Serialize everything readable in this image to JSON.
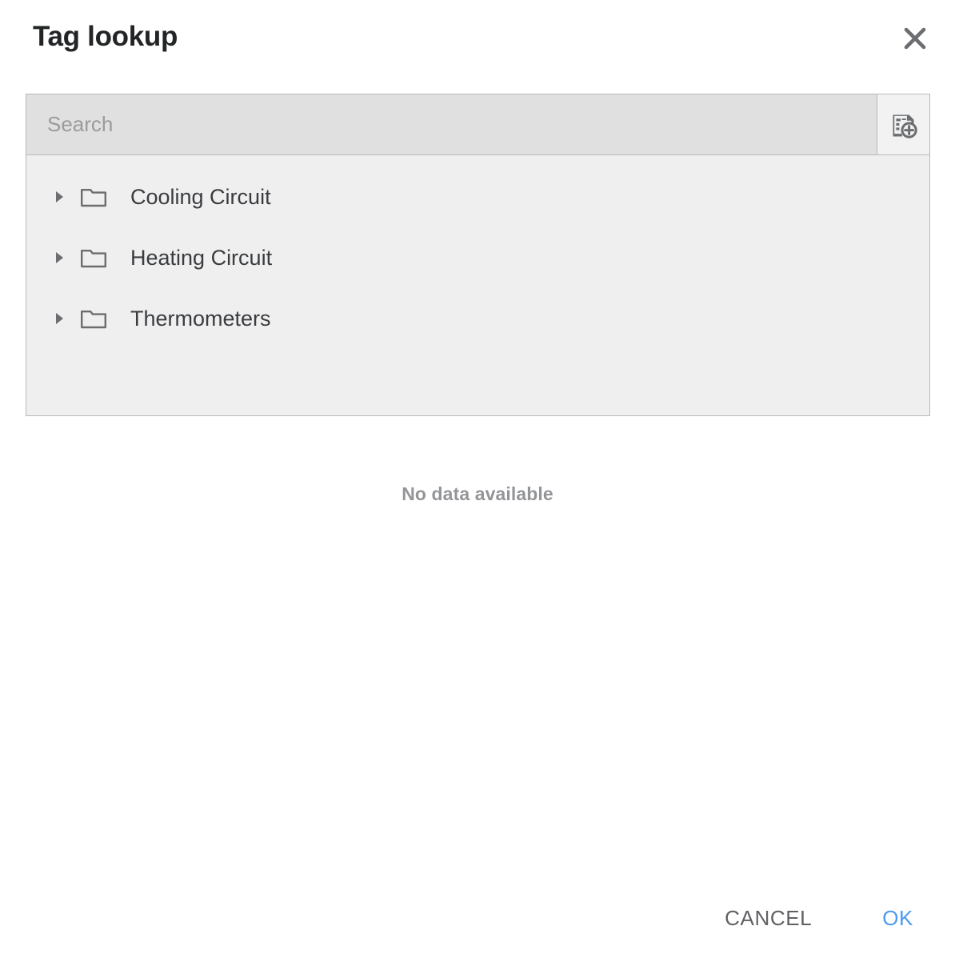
{
  "dialog": {
    "title": "Tag lookup",
    "close_icon": "close-icon"
  },
  "search": {
    "value": "",
    "placeholder": "Search",
    "action_icon": "add-tag-icon",
    "action_title": "Add tag"
  },
  "tree": {
    "items": [
      {
        "label": "Cooling Circuit",
        "icon": "folder-icon",
        "expanded": false
      },
      {
        "label": "Heating Circuit",
        "icon": "folder-icon",
        "expanded": false
      },
      {
        "label": "Thermometers",
        "icon": "folder-icon",
        "expanded": false
      }
    ]
  },
  "content": {
    "empty_message": "No data available"
  },
  "footer": {
    "cancel_label": "CANCEL",
    "ok_label": "OK"
  },
  "colors": {
    "accent": "#4c9af1",
    "panel_bg": "#efefef",
    "search_bg": "#e0e0e0",
    "border": "#b9b9b9",
    "text": "#3a3c40",
    "muted": "#939598"
  }
}
